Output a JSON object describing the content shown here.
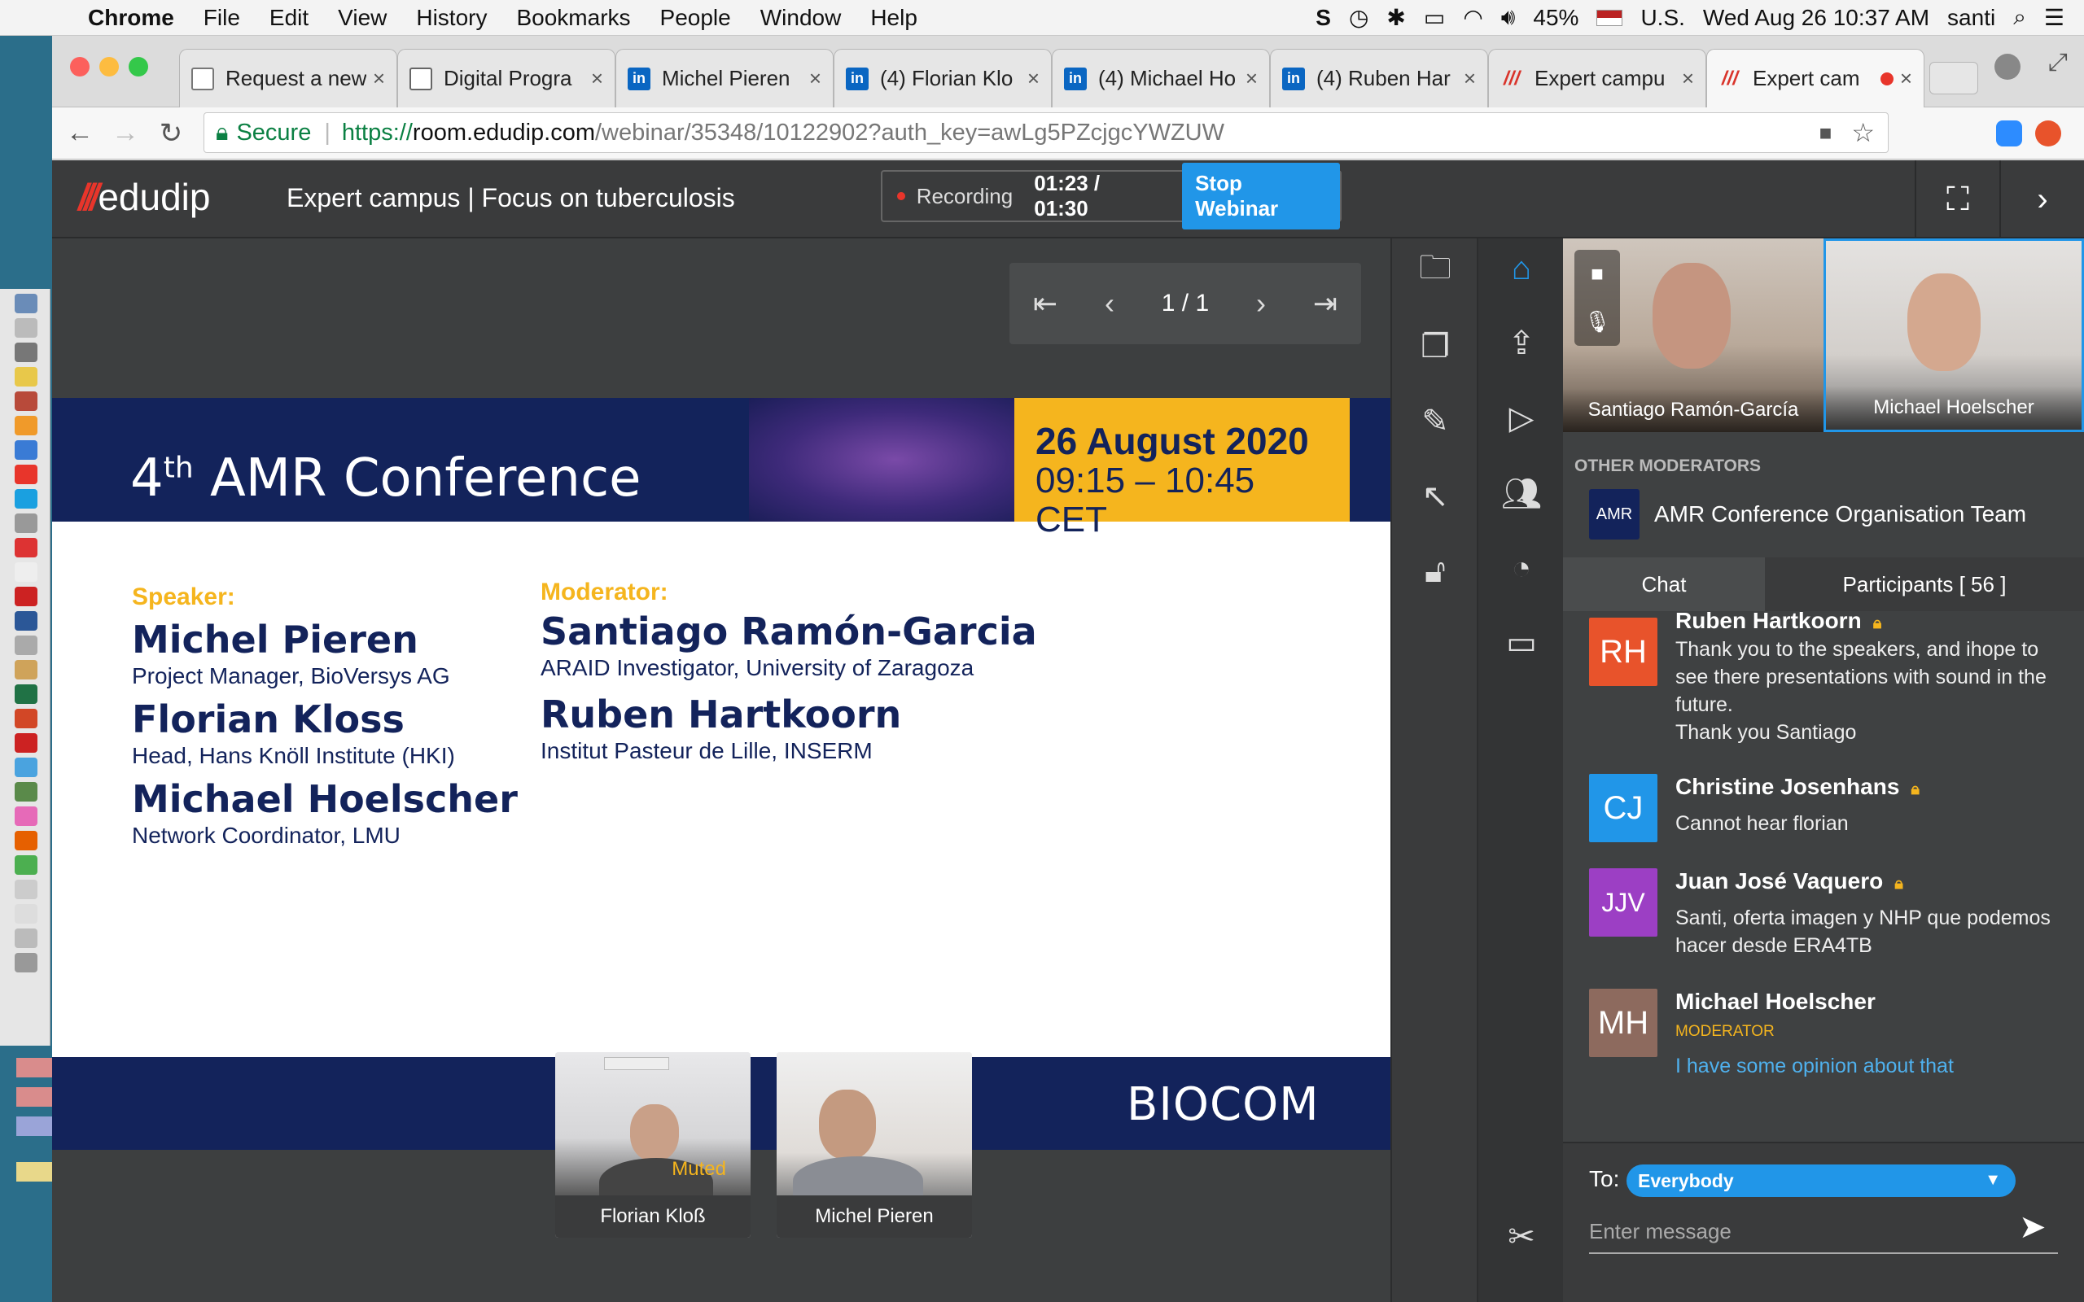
{
  "menubar": {
    "app": "Chrome",
    "items": [
      "File",
      "Edit",
      "View",
      "History",
      "Bookmarks",
      "People",
      "Window",
      "Help"
    ],
    "battery": "45%",
    "input_source": "U.S.",
    "clock": "Wed Aug 26  10:37 AM",
    "user": "santi"
  },
  "tabs": [
    {
      "title": "Request a new",
      "icon": "calendar-icon"
    },
    {
      "title": "Digital Progra",
      "icon": "document-icon"
    },
    {
      "title": "Michel Pieren",
      "icon": "linkedin-icon"
    },
    {
      "title": "(4) Florian Klo",
      "icon": "linkedin-icon"
    },
    {
      "title": "(4) Michael Ho",
      "icon": "linkedin-icon"
    },
    {
      "title": "(4) Ruben Har",
      "icon": "linkedin-icon"
    },
    {
      "title": "Expert campu",
      "icon": "edudip-icon"
    },
    {
      "title": "Expert cam",
      "icon": "edudip-icon"
    }
  ],
  "address": {
    "secure_label": "Secure",
    "scheme": "https://",
    "host": "room.edudip.com",
    "path": "/webinar/35348/10122902?auth_key=awLg5PZcjgcYWZUW"
  },
  "webinar": {
    "logo_text": "edudip",
    "title": "Expert campus | Focus on tuberculosis",
    "recording_label": "Recording",
    "recording_time": "01:23 / 01:30",
    "stop_button": "Stop Webinar"
  },
  "pager": {
    "count": "1 / 1"
  },
  "slide": {
    "title_prefix": "4",
    "title_sup": "th",
    "title_rest": " AMR Conference",
    "date": "26 August 2020",
    "time": "09:15 – 10:45 CET",
    "speaker_label": "Speaker:",
    "moderator_label": "Moderator:",
    "speakers": [
      {
        "name": "Michel Pieren",
        "role": "Project Manager, BioVersys AG"
      },
      {
        "name": "Florian Kloss",
        "role": "Head, Hans Knöll Institute (HKI)"
      },
      {
        "name": "Michael Hoelscher",
        "role": "Network Coordinator, LMU"
      }
    ],
    "moderators": [
      {
        "name": "Santiago Ramón-Garcia",
        "role": "ARAID Investigator, University of Zaragoza"
      },
      {
        "name": "Ruben Hartkoorn",
        "role": "Institut Pasteur de Lille, INSERM"
      }
    ],
    "footer_brand": "BIOCOM"
  },
  "cams": [
    {
      "name": "Florian Kloß",
      "status": "Muted"
    },
    {
      "name": "Michel Pieren",
      "status": ""
    }
  ],
  "videos": [
    {
      "name": "Santiago Ramón-García"
    },
    {
      "name": "Michael Hoelscher"
    }
  ],
  "side": {
    "other_moderators_label": "OTHER MODERATORS",
    "moderator_team_logo": "AMR",
    "moderator_team": "AMR Conference Organisation Team",
    "chat_tab": "Chat",
    "participants_tab": "Participants [ 56 ]"
  },
  "chat": [
    {
      "initials": "RH",
      "name": "Ruben Hartkoorn",
      "color": "#e8532b",
      "text": [
        "Thank you to the speakers, and ihope to",
        "see there presentations with sound in the",
        "future.",
        "Thank you Santiago"
      ]
    },
    {
      "initials": "CJ",
      "name": "Christine Josenhans",
      "color": "#2196e8",
      "text": [
        "Cannot hear florian"
      ]
    },
    {
      "initials": "JJV",
      "name": "Juan José Vaquero",
      "color": "#9c3fc4",
      "text": [
        "Santi, oferta imagen y NHP que podemos",
        "hacer desde ERA4TB"
      ]
    },
    {
      "initials": "MH",
      "name": "Michael Hoelscher",
      "color": "#8d6a5e",
      "role": "MODERATOR",
      "text": [
        "I have some opinion about that"
      ]
    }
  ],
  "composer": {
    "to_label": "To:",
    "recipient": "Everybody",
    "placeholder": "Enter message"
  },
  "colors": {
    "accent": "#2196e8",
    "brand_red": "#e8352b",
    "slide_navy": "#13235b",
    "slide_gold": "#f5b51e"
  }
}
